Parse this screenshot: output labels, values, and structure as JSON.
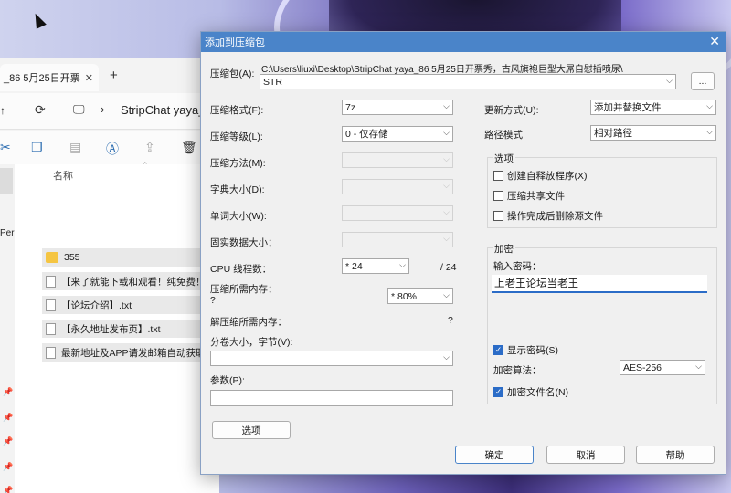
{
  "explorer": {
    "tab_title": "_86 5月25日开票",
    "path_text": "StripChat yaya_8",
    "column_name": "名称",
    "sidebar_partial": "Per",
    "files": [
      {
        "name": "355",
        "type": "folder"
      },
      {
        "name": "【来了就能下载和观看！纯免费！",
        "type": "doc"
      },
      {
        "name": "【论坛介绍】.txt",
        "type": "doc"
      },
      {
        "name": "【永久地址发布页】.txt",
        "type": "doc"
      },
      {
        "name": "最新地址及APP请发邮箱自动获取",
        "type": "doc"
      }
    ]
  },
  "dialog": {
    "title": "添加到压缩包",
    "archive_label": "压缩包(A):",
    "archive_path": "C:\\Users\\liuxi\\Desktop\\StripChat yaya_86 5月25日开票秀，古风旗袍巨型大屌自慰插喷尿\\",
    "archive_name": "STR",
    "browse_label": "...",
    "format_label": "压缩格式(F):",
    "format_value": "7z",
    "level_label": "压缩等级(L):",
    "level_value": "0 - 仅存储",
    "method_label": "压缩方法(M):",
    "dict_label": "字典大小(D):",
    "word_label": "单词大小(W):",
    "solid_label": "固实数据大小：",
    "threads_label": "CPU 线程数：",
    "threads_value": "* 24",
    "threads_max": "/ 24",
    "mem_comp_label": "压缩所需内存：",
    "mem_comp_value": "?",
    "mem_pct_value": "* 80%",
    "mem_decomp_label": "解压缩所需内存：",
    "mem_decomp_value": "?",
    "split_label": "分卷大小，字节(V):",
    "params_label": "参数(P):",
    "options_button": "选项",
    "update_label": "更新方式(U):",
    "update_value": "添加并替换文件",
    "pathmode_label": "路径模式",
    "pathmode_value": "相对路径",
    "options_group": "选项",
    "opt_sfx": "创建自释放程序(X)",
    "opt_shared": "压缩共享文件",
    "opt_delete": "操作完成后删除源文件",
    "encrypt_group": "加密",
    "pwd_label": "输入密码：",
    "pwd_value": "上老王论坛当老王",
    "show_pwd": "显示密码(S)",
    "algo_label": "加密算法：",
    "algo_value": "AES-256",
    "encrypt_names": "加密文件名(N)",
    "ok": "确定",
    "cancel": "取消",
    "help": "帮助"
  }
}
